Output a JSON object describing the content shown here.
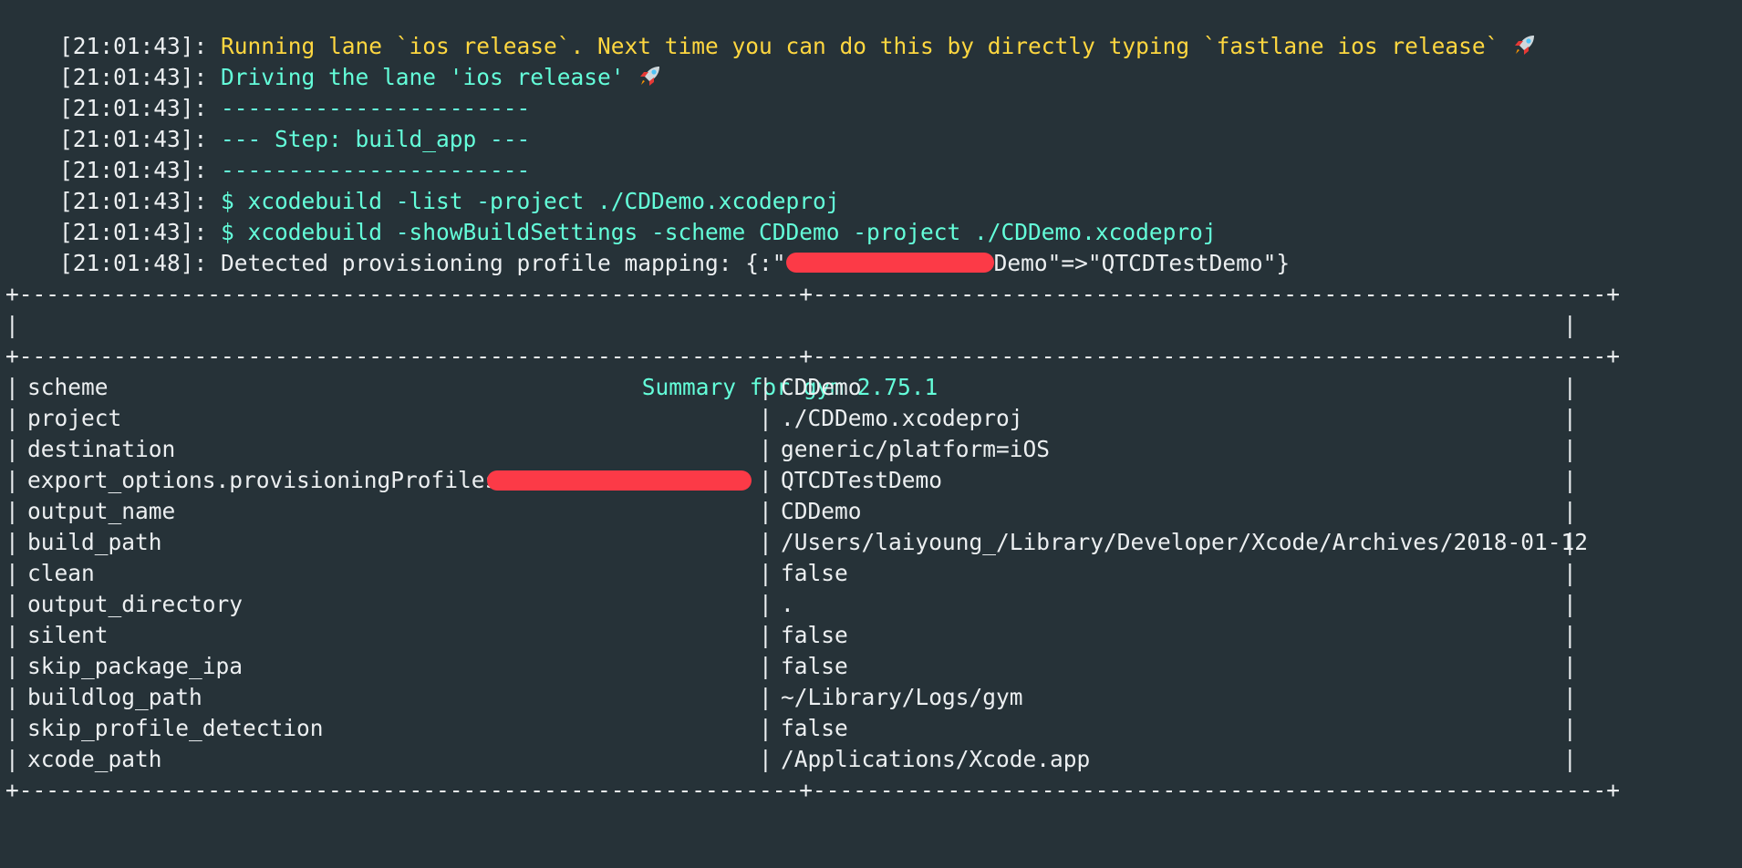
{
  "log_lines": [
    {
      "timestamp": "[21:01:43]:",
      "text": "Running lane `ios release`. Next time you can do this by directly typing `fastlane ios release`",
      "color": "#ffd740",
      "icon": "rocket-icon"
    },
    {
      "timestamp": "[21:01:43]:",
      "text": "Driving the lane 'ios release'",
      "color": "#64ffda",
      "icon": "rocket-icon"
    },
    {
      "timestamp": "[21:01:43]:",
      "text": "-----------------------",
      "color": "#64ffda"
    },
    {
      "timestamp": "[21:01:43]:",
      "text": "--- Step: build_app ---",
      "color": "#64ffda"
    },
    {
      "timestamp": "[21:01:43]:",
      "text": "-----------------------",
      "color": "#64ffda"
    },
    {
      "timestamp": "[21:01:43]:",
      "text": "$ xcodebuild -list -project ./CDDemo.xcodeproj",
      "color": "#64ffda"
    },
    {
      "timestamp": "[21:01:43]:",
      "text": "$ xcodebuild -showBuildSettings -scheme CDDemo -project ./CDDemo.xcodeproj",
      "color": "#64ffda"
    },
    {
      "timestamp": "[21:01:48]:",
      "text_before": "Detected provisioning profile mapping: {:\"",
      "text_after": "Demo\"=>\"QTCDTestDemo\"}",
      "color": "#eceff1"
    }
  ],
  "summary": {
    "border": "+----------------------------------------------------------+-----------------------------------------------------------+",
    "title": "Summary for gym 2.75.1",
    "rows": [
      {
        "key": "scheme",
        "value": "CDDemo"
      },
      {
        "key": "project",
        "value": "./CDDemo.xcodeproj"
      },
      {
        "key": "destination",
        "value": "generic/platform=iOS"
      },
      {
        "key": "export_options.provisioningProfiles.",
        "value": "QTCDTestDemo"
      },
      {
        "key": "output_name",
        "value": "CDDemo"
      },
      {
        "key": "build_path",
        "value": "/Users/laiyoung_/Library/Developer/Xcode/Archives/2018-01-12"
      },
      {
        "key": "clean",
        "value": "false"
      },
      {
        "key": "output_directory",
        "value": "."
      },
      {
        "key": "silent",
        "value": "false"
      },
      {
        "key": "skip_package_ipa",
        "value": "false"
      },
      {
        "key": "buildlog_path",
        "value": "~/Library/Logs/gym"
      },
      {
        "key": "skip_profile_detection",
        "value": "false"
      },
      {
        "key": "xcode_path",
        "value": "/Applications/Xcode.app"
      }
    ]
  },
  "colors": {
    "background": "#263238",
    "timestamp": "#eceff1",
    "yellow": "#ffd740",
    "cyan": "#64ffda",
    "redaction": "#fc3a47"
  }
}
